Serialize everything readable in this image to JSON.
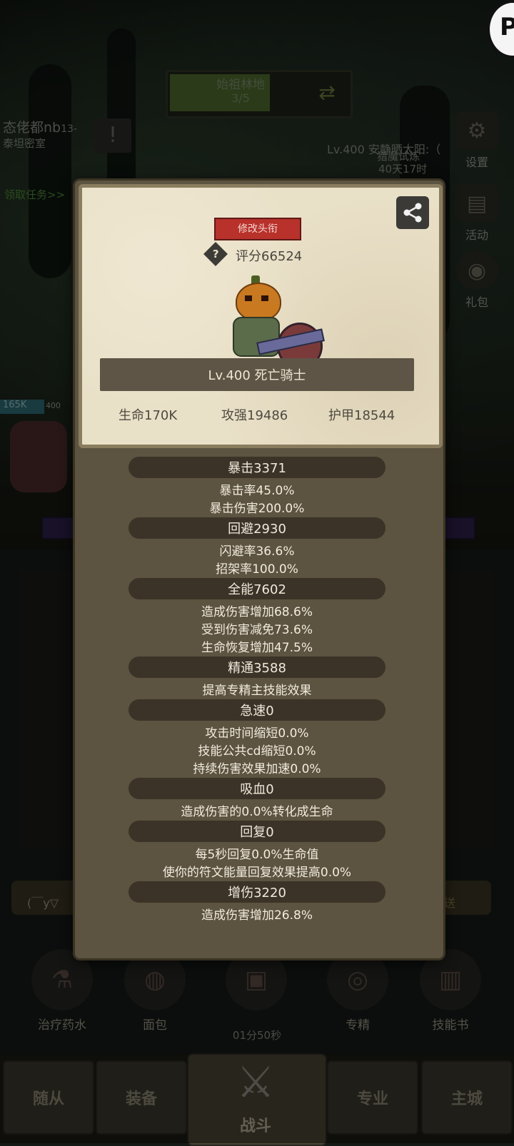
{
  "background": {
    "location_name": "始祖林地",
    "location_progress": "3/5",
    "guild_name": "态佬都nb",
    "guild_sub_suffix": "13-",
    "guild_place": "泰坦密室",
    "quest_link": "领取任务>>",
    "player_line1": "Lv.400 安静晒太阳:（",
    "player_line2": "猎魔试炼",
    "player_timer": "40天17时",
    "hp_tag": "165K",
    "level_tag": "400",
    "side_menu": [
      {
        "label": "设置",
        "icon": "gear-icon"
      },
      {
        "label": "活动",
        "icon": "scroll-icon"
      },
      {
        "label": "礼包",
        "icon": "gift-icon"
      }
    ],
    "chat_text": "(￣y▽",
    "send_label": "发送",
    "skills": [
      {
        "label": "治疗药水",
        "icon": "potion-icon"
      },
      {
        "label": "面包",
        "icon": "bread-icon"
      },
      {
        "label": "",
        "icon": "chest-icon"
      },
      {
        "label": "专精",
        "icon": "specialization-icon"
      },
      {
        "label": "技能书",
        "icon": "book-icon"
      }
    ],
    "timer": "01分50秒",
    "nav": {
      "followers": "随从",
      "equipment": "装备",
      "battle": "战斗",
      "profession": "专业",
      "city": "主城"
    }
  },
  "card": {
    "edit_title_label": "修改头衔",
    "score": "评分66524",
    "character_name": "Lv.400 死亡骑士",
    "hp": "生命170K",
    "attack": "攻强19486",
    "armor": "护甲18544"
  },
  "stats": [
    {
      "header": "暴击3371",
      "lines": [
        "暴击率45.0%",
        "暴击伤害200.0%"
      ]
    },
    {
      "header": "回避2930",
      "lines": [
        "闪避率36.6%",
        "招架率100.0%"
      ]
    },
    {
      "header": "全能7602",
      "lines": [
        "造成伤害增加68.6%",
        "受到伤害减免73.6%",
        "生命恢复增加47.5%"
      ]
    },
    {
      "header": "精通3588",
      "lines": [
        "提高专精主技能效果"
      ]
    },
    {
      "header": "急速0",
      "lines": [
        "攻击时间缩短0.0%",
        "技能公共cd缩短0.0%",
        "持续伤害效果加速0.0%"
      ]
    },
    {
      "header": "吸血0",
      "lines": [
        "造成伤害的0.0%转化成生命"
      ]
    },
    {
      "header": "回复0",
      "lines": [
        "每5秒回复0.0%生命值",
        "使你的符文能量回复效果提高0.0%"
      ]
    },
    {
      "header": "增伤3220",
      "lines": [
        "造成伤害增加26.8%"
      ]
    }
  ],
  "colors": {
    "accent_red": "#b8312b",
    "panel": "#5c5340",
    "card": "#e9e0c8",
    "pill": "#3b3327"
  }
}
